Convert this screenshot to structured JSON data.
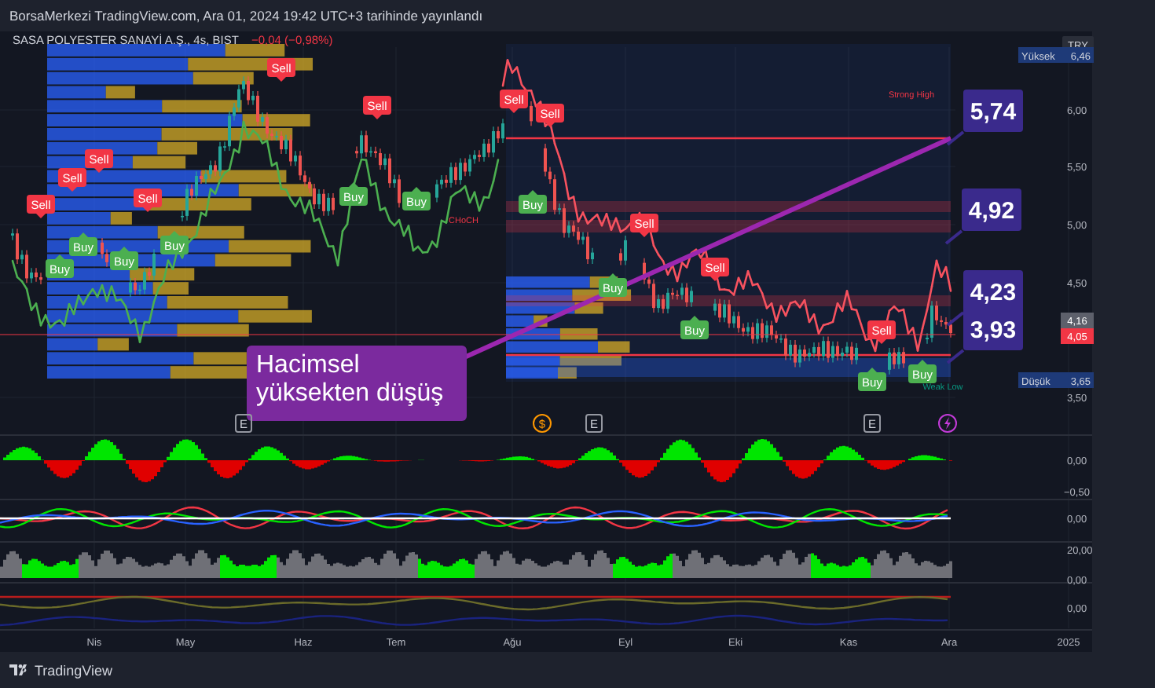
{
  "header": {
    "text": "BorsaMerkezi TradingView.com, Ara 01, 2024 19:42 UTC+3 tarihinde yayınlandı"
  },
  "symbol": {
    "name": "SASA POLYESTER SANAYİ A.Ş., 4s, BIST",
    "change": "−0,04 (−0,98%)"
  },
  "signals": [
    {
      "kind": "sell",
      "label": "Sell"
    },
    {
      "kind": "sell",
      "label": "Sell"
    },
    {
      "kind": "sell",
      "label": "Sell"
    },
    {
      "kind": "sell",
      "label": "Sell"
    },
    {
      "kind": "sell",
      "label": "Sell"
    },
    {
      "kind": "sell",
      "label": "Sell"
    },
    {
      "kind": "buy",
      "label": "Buy"
    },
    {
      "kind": "buy",
      "label": "Buy"
    },
    {
      "kind": "buy",
      "label": "Buy"
    },
    {
      "kind": "buy",
      "label": "Buy"
    },
    {
      "kind": "buy",
      "label": "Buy"
    },
    {
      "kind": "buy",
      "label": "Buy"
    },
    {
      "kind": "sell",
      "label": "Sell"
    },
    {
      "kind": "sell",
      "label": "Sell"
    },
    {
      "kind": "buy",
      "label": "Buy"
    },
    {
      "kind": "sell",
      "label": "Sell"
    },
    {
      "kind": "buy",
      "label": "Buy"
    },
    {
      "kind": "sell",
      "label": "Sell"
    },
    {
      "kind": "buy",
      "label": "Buy"
    },
    {
      "kind": "sell",
      "label": "Sell"
    },
    {
      "kind": "buy",
      "label": "Buy"
    },
    {
      "kind": "buy",
      "label": "Buy"
    }
  ],
  "small_labels": [
    {
      "text": "CHoCH",
      "color": "#f23645"
    },
    {
      "text": "Strong High",
      "color": "#f23645"
    },
    {
      "text": "Weak Low",
      "color": "#089981"
    }
  ],
  "annotation": {
    "text": "Hacimsel yüksekten düşüş"
  },
  "callouts": [
    "5,74",
    "4,92",
    "4,23",
    "3,93"
  ],
  "events": [
    {
      "kind": "earnings",
      "label": "E"
    },
    {
      "kind": "dividend",
      "label": "$"
    },
    {
      "kind": "earnings",
      "label": "E"
    },
    {
      "kind": "earnings",
      "label": "E"
    },
    {
      "kind": "news"
    }
  ],
  "price_axis": {
    "currency": "TRY",
    "high": {
      "label": "Yüksek",
      "value": "6,46"
    },
    "low": {
      "label": "Düşük",
      "value": "3,65"
    },
    "ticks": [
      "6,00",
      "5,50",
      "5,00",
      "4,50",
      "3,50"
    ],
    "last_prices": [
      {
        "value": "4,16",
        "color": "#5d606b"
      },
      {
        "value": "4,05",
        "color": "#f23645"
      }
    ]
  },
  "indicator_axis": [
    "0,00",
    "−0,50",
    "0,00",
    "20,00",
    "0,00",
    "0,00"
  ],
  "time_axis": [
    "Nis",
    "May",
    "Haz",
    "Tem",
    "Ağu",
    "Eyl",
    "Eki",
    "Kas",
    "Ara",
    "2025"
  ],
  "footer": {
    "brand": "TradingView"
  }
}
